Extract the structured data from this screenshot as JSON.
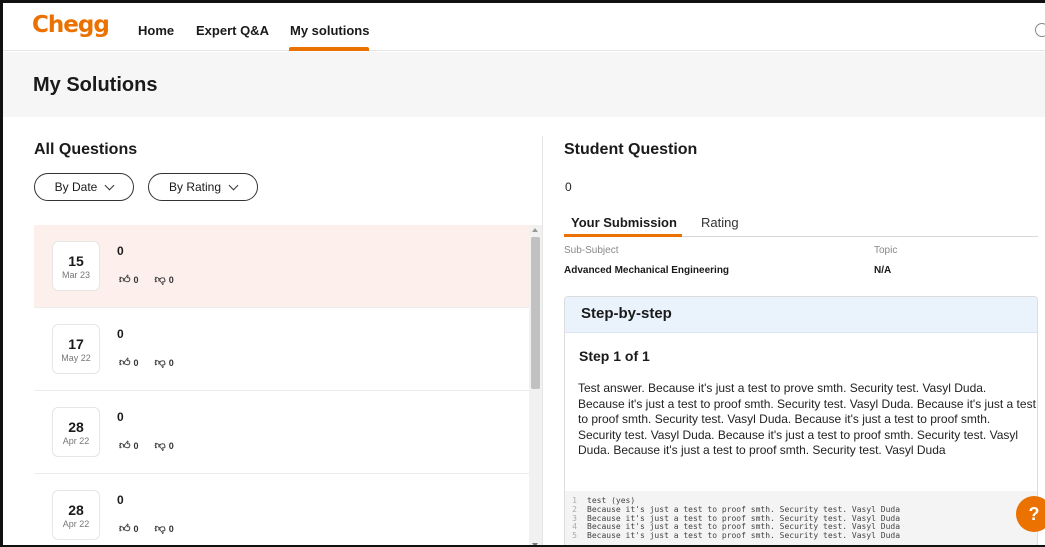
{
  "nav": {
    "logo": "Chegg",
    "links": [
      "Home",
      "Expert Q&A",
      "My solutions"
    ],
    "active": "My solutions"
  },
  "page": {
    "title": "My Solutions"
  },
  "left": {
    "heading": "All Questions",
    "filters": {
      "date": "By Date",
      "rating": "By Rating"
    },
    "questions": [
      {
        "day": "15",
        "month": "Mar 23",
        "title": "0",
        "likes": "0",
        "dislikes": "0",
        "selected": true
      },
      {
        "day": "17",
        "month": "May 22",
        "title": "0",
        "likes": "0",
        "dislikes": "0",
        "selected": false
      },
      {
        "day": "28",
        "month": "Apr 22",
        "title": "0",
        "likes": "0",
        "dislikes": "0",
        "selected": false
      },
      {
        "day": "28",
        "month": "Apr 22",
        "title": "0",
        "likes": "0",
        "dislikes": "0",
        "selected": false
      }
    ]
  },
  "right": {
    "heading": "Student Question",
    "question_body": "0",
    "tabs": [
      "Your Submission",
      "Rating"
    ],
    "meta": {
      "subsubject_label": "Sub-Subject",
      "subsubject_value": "Advanced Mechanical Engineering",
      "topic_label": "Topic",
      "topic_value": "N/A"
    },
    "step_card": {
      "title": "Step-by-step",
      "step_label": "Step 1 of 1",
      "text": "Test answer. Because it's just a test to prove smth. Security test. Vasyl Duda. Because it's just a test to proof smth. Security test. Vasyl Duda. Because it's just a test to proof smth. Security test. Vasyl Duda. Because it's just a test to proof smth. Security test. Vasyl Duda. Because it's just a test to proof smth. Security test. Vasyl Duda. Because it's just a test to proof smth. Security test. Vasyl Duda",
      "code_lines": [
        {
          "n": "1",
          "text": "test (yes)"
        },
        {
          "n": "2",
          "text": "Because it's just a test to proof smth. Security test. Vasyl Duda"
        },
        {
          "n": "3",
          "text": "Because it's just a test to proof smth. Security test. Vasyl Duda"
        },
        {
          "n": "4",
          "text": "Because it's just a test to proof smth. Security test. Vasyl Duda"
        },
        {
          "n": "5",
          "text": "Because it's just a test to proof smth. Security test. Vasyl Duda"
        }
      ]
    }
  },
  "help": {
    "label": "?"
  },
  "icons": {
    "user": "user-icon",
    "like": "thumbs-up-icon",
    "dislike": "thumbs-down-icon"
  },
  "colors": {
    "accent": "#eb7100",
    "selected_row": "#fdf0ec",
    "step_header": "#eaf2fb"
  }
}
